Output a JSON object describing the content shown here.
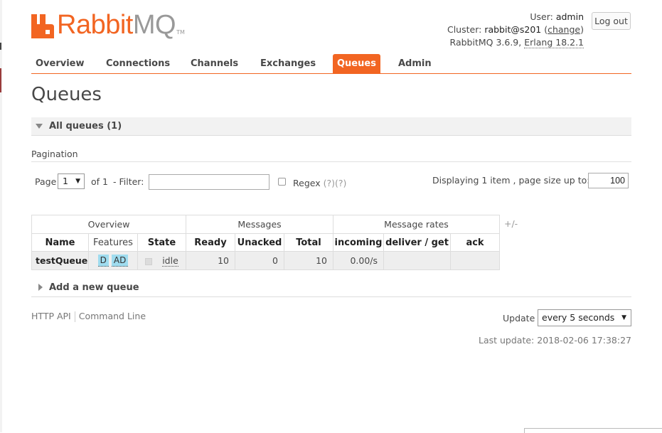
{
  "brand": {
    "rabbit": "Rabbit",
    "mq": "MQ",
    "tm": "TM",
    "accent": "#f26522"
  },
  "header": {
    "user_label": "User:",
    "user": "admin",
    "cluster_label": "Cluster:",
    "cluster": "rabbit@s201",
    "change_label": "change",
    "version": "RabbitMQ 3.6.9,",
    "erlang": "Erlang 18.2.1",
    "logout_label": "Log out"
  },
  "nav": {
    "tabs": [
      {
        "label": "Overview"
      },
      {
        "label": "Connections"
      },
      {
        "label": "Channels"
      },
      {
        "label": "Exchanges"
      },
      {
        "label": "Queues",
        "active": true
      },
      {
        "label": "Admin"
      }
    ]
  },
  "page": {
    "title": "Queues"
  },
  "all_queues": {
    "label": "All queues (1)"
  },
  "pagination": {
    "label": "Pagination",
    "page_label": "Page",
    "page_value": "1",
    "of_label": "of 1",
    "filter_label": "- Filter:",
    "filter_value": "",
    "regex_label": "Regex",
    "regex_help": "(?)(?)",
    "display_label": "Displaying 1 item , page size up to:",
    "page_size": "100"
  },
  "table": {
    "groups": [
      "Overview",
      "Messages",
      "Message rates"
    ],
    "plus_minus": "+/-",
    "columns": [
      "Name",
      "Features",
      "State",
      "Ready",
      "Unacked",
      "Total",
      "incoming",
      "deliver / get",
      "ack"
    ],
    "rows": [
      {
        "name": "testQueue",
        "features": [
          "D",
          "AD"
        ],
        "state": "idle",
        "ready": "10",
        "unacked": "0",
        "total": "10",
        "incoming": "0.00/s",
        "deliver_get": "",
        "ack": ""
      }
    ]
  },
  "add_queue": {
    "label": "Add a new queue"
  },
  "footer": {
    "http_api": "HTTP API",
    "command_line": "Command Line",
    "update_label": "Update",
    "update_value": "every 5 seconds",
    "last_update": "Last update: 2018-02-06 17:38:27"
  }
}
